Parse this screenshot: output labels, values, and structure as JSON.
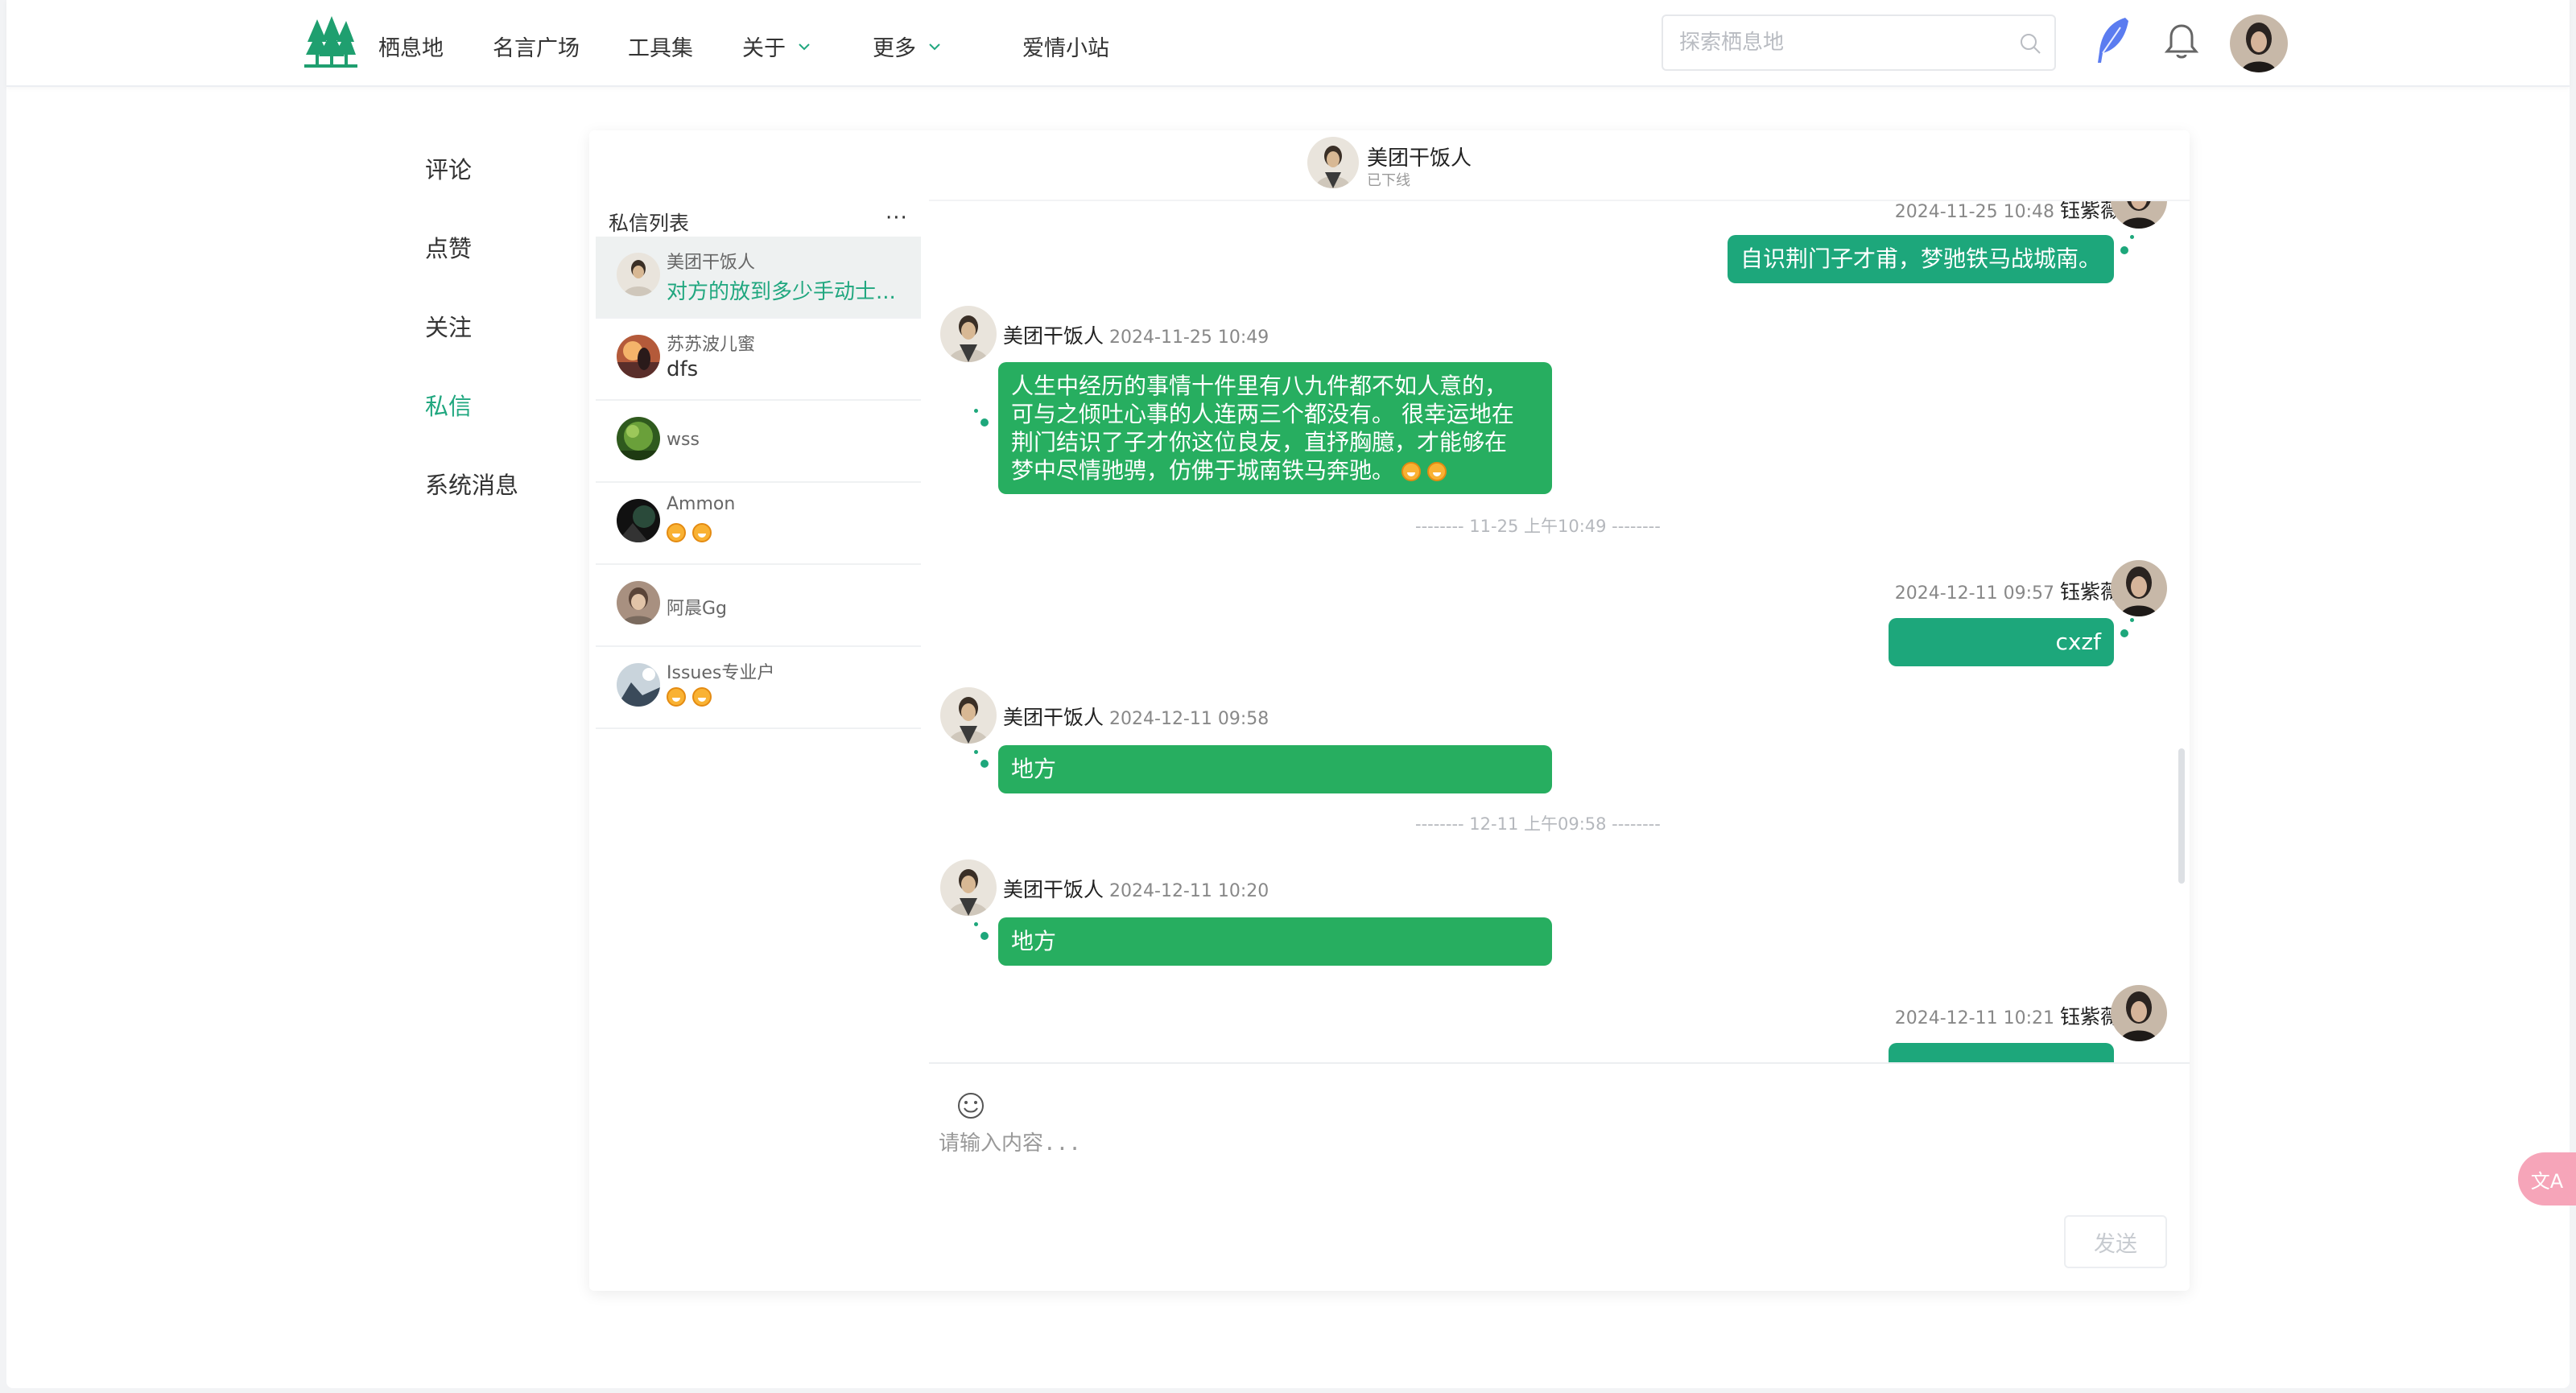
{
  "nav": {
    "items": [
      "栖息地",
      "名言广场",
      "工具集",
      "关于",
      "更多",
      "爱情小站"
    ],
    "search_placeholder": "探索栖息地"
  },
  "sidebar": {
    "items": [
      "评论",
      "点赞",
      "关注",
      "私信",
      "系统消息"
    ],
    "active": "私信"
  },
  "chat_header": {
    "name": "美团干饭人",
    "status": "已下线"
  },
  "conversation_list": {
    "title": "私信列表",
    "more": "···",
    "items": [
      {
        "name": "美团干饭人",
        "message": "对方的放到多少手动士..."
      },
      {
        "name": "苏苏波儿蜜",
        "message": "dfs"
      },
      {
        "name": "wss",
        "message": ""
      },
      {
        "name": "Ammon",
        "message": ""
      },
      {
        "name": "阿晨Gg",
        "message": ""
      },
      {
        "name": "Issues专业户",
        "message": ""
      }
    ]
  },
  "messages": [
    {
      "side": "right",
      "time": "2024-11-25 10:48",
      "sender": "钰紫薇",
      "text": "自识荆门子才甫，梦驰铁马战城南。"
    },
    {
      "side": "left",
      "sender": "美团干饭人",
      "time": "2024-11-25 10:49",
      "lines": [
        "人生中经历的事情十件里有八九件都不如人意的，",
        "可与之倾吐心事的人连两三个都没有。 很幸运地在",
        "荆门结识了子才你这位良友，直抒胸臆，才能够在",
        "梦中尽情驰骋，仿佛于城南铁马奔驰。"
      ]
    },
    {
      "divider": "-------- 11-25 上午10:49 --------"
    },
    {
      "side": "right",
      "time": "2024-12-11 09:57",
      "sender": "钰紫薇",
      "text": "cxzf"
    },
    {
      "side": "left",
      "sender": "美团干饭人",
      "time": "2024-12-11 09:58",
      "text": "地方"
    },
    {
      "divider": "-------- 12-11 上午09:58 --------"
    },
    {
      "side": "left",
      "sender": "美团干饭人",
      "time": "2024-12-11 10:20",
      "text": "地方"
    },
    {
      "side": "right",
      "time": "2024-12-11 10:21",
      "sender": "钰紫薇",
      "text": ""
    }
  ],
  "composer": {
    "placeholder": "请输入内容...",
    "send_label": "发送"
  },
  "translate_label": "文A",
  "colors": {
    "accent": "#20a77f",
    "bubble_left": "#27ae60",
    "bubble_right": "#1da77b"
  }
}
